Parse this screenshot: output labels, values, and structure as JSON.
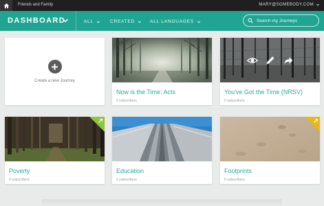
{
  "topbar": {
    "org_name": "Friends and Family",
    "user_email": "MARY@SOMEBODY.COM"
  },
  "navbar": {
    "title": "DASHBOARD",
    "filters": [
      {
        "label": "ALL"
      },
      {
        "label": "CREATED"
      },
      {
        "label": "ALL LANGUAGES"
      }
    ],
    "search_placeholder": "Search my Journeys"
  },
  "create_card": {
    "label": "Create a new Journey"
  },
  "journeys": [
    {
      "title": "Now is the Time: Acts",
      "subscribers": "0 subscribers",
      "image": "misty-forest",
      "corner_badge": null
    },
    {
      "title": "You've Got the Time (NRSV)",
      "subscribers": "0 subscribers",
      "image": "winter-trees",
      "corner_badge": null,
      "hover_actions": [
        "eye-icon",
        "pencil-icon",
        "share-icon"
      ]
    },
    {
      "title": "Poverty",
      "subscribers": "0 subscribers",
      "image": "pine-forest",
      "corner_badge": {
        "color": "#8dc63f",
        "icon": "share-arrow-icon"
      }
    },
    {
      "title": "Education",
      "subscribers": "0 subscribers",
      "image": "waterslide",
      "corner_badge": null
    },
    {
      "title": "Footprints",
      "subscribers": "0 subscribers",
      "image": "sand",
      "corner_badge": {
        "color": "#e8b71a",
        "icon": "share-arrow-icon"
      }
    }
  ],
  "colors": {
    "topbar": "#1f1f1f",
    "navbar": "#21a593",
    "accent_text": "#2aa896",
    "background": "#e9eaea"
  }
}
